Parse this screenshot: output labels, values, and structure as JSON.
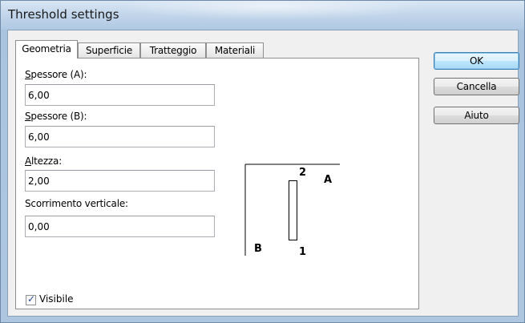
{
  "window": {
    "title": "Threshold settings"
  },
  "tabs": [
    {
      "label": "Geometria",
      "active": true
    },
    {
      "label": "Superficie",
      "active": false
    },
    {
      "label": "Tratteggio",
      "active": false
    },
    {
      "label": "Materiali",
      "active": false
    }
  ],
  "fields": {
    "spessore_a": {
      "label_key": "S",
      "label_rest": "pessore (A):",
      "value": "6,00"
    },
    "spessore_b": {
      "label_key": "S",
      "label_rest": "pessore (B):",
      "value": "6,00"
    },
    "altezza": {
      "label_key": "A",
      "label_rest": "ltezza:",
      "value": "2,00"
    },
    "scorrimento": {
      "label": "Scorrimento verticale:",
      "value": "0,00"
    }
  },
  "visible": {
    "label": "Visibile",
    "checked": true
  },
  "diagram": {
    "label_2": "2",
    "label_a": "A",
    "label_b": "B",
    "label_1": "1"
  },
  "buttons": {
    "ok": "OK",
    "cancel": "Cancella",
    "help": "Aiuto"
  },
  "colors": {
    "check_mark": "#2a4d8e",
    "default_button_border": "#3c7fb1"
  }
}
